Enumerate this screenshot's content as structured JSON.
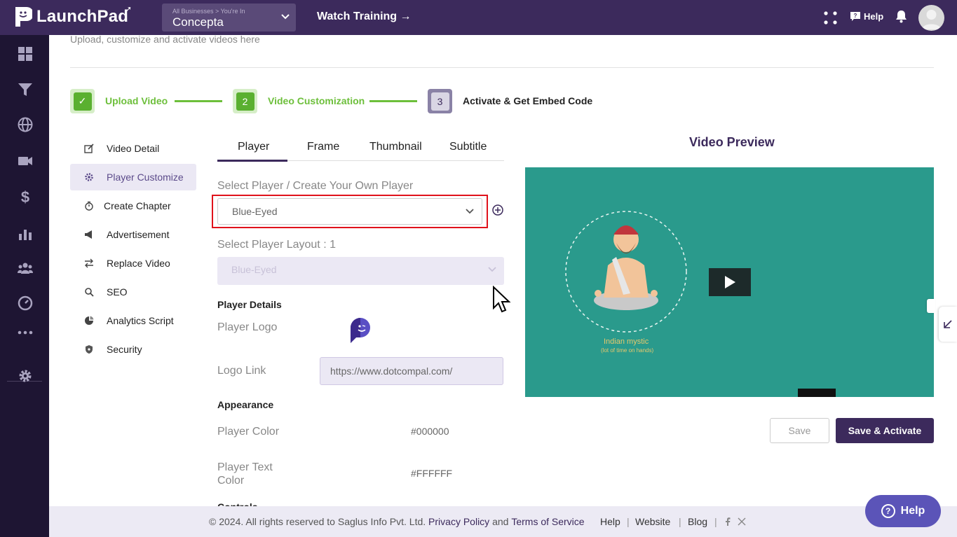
{
  "app": {
    "name": "LaunchPad",
    "business_crumb": "All Businesses  >  You're In",
    "business_name": "Concepta",
    "watch_training": "Watch Training →",
    "help_label": "Help"
  },
  "page": {
    "subtitle": "Upload, customize and activate videos here"
  },
  "steps": [
    {
      "number": "✓",
      "label": "Upload Video"
    },
    {
      "number": "2",
      "label": "Video Customization"
    },
    {
      "number": "3",
      "label": "Activate & Get Embed Code"
    }
  ],
  "menu": [
    {
      "label": "Video Detail"
    },
    {
      "label": "Player Customize"
    },
    {
      "label": "Create Chapter"
    },
    {
      "label": "Advertisement"
    },
    {
      "label": "Replace Video"
    },
    {
      "label": "SEO"
    },
    {
      "label": "Analytics Script"
    },
    {
      "label": "Security"
    }
  ],
  "tabs": [
    {
      "label": "Player"
    },
    {
      "label": "Frame"
    },
    {
      "label": "Thumbnail"
    },
    {
      "label": "Subtitle"
    }
  ],
  "form": {
    "select_player_label": "Select Player / Create Your Own Player",
    "select_player_value": "Blue-Eyed",
    "select_layout_label": "Select Player Layout : 1",
    "select_layout_value": "Blue-Eyed",
    "player_details": "Player Details",
    "player_logo": "Player Logo",
    "logo_link_label": "Logo Link",
    "logo_link_value": "https://www.dotcompal.com/",
    "appearance": "Appearance",
    "player_color_label": "Player Color",
    "player_color_value": "#000000",
    "player_text_color_label_1": "Player Text",
    "player_text_color_label_2": "Color",
    "player_text_color_value": "#FFFFFF",
    "controls": "Controls"
  },
  "preview": {
    "title": "Video Preview",
    "caption1": "Indian mystic",
    "caption2": "(lot of time on hands)"
  },
  "actions": {
    "save": "Save",
    "save_activate": "Save & Activate"
  },
  "footer": {
    "copyright": "©  2024. All rights reserved to Saglus Info Pvt. Ltd.",
    "privacy": "Privacy Policy",
    "and": "and",
    "terms": "Terms of Service",
    "help": "Help",
    "website": "Website",
    "blog": "Blog"
  },
  "help_widget": {
    "label": "Help"
  },
  "colors": {
    "brand": "#3c2a5c",
    "accent_green": "#6dbf3b",
    "video_bg": "#2a9a8c",
    "highlight_red": "#e0121b"
  }
}
